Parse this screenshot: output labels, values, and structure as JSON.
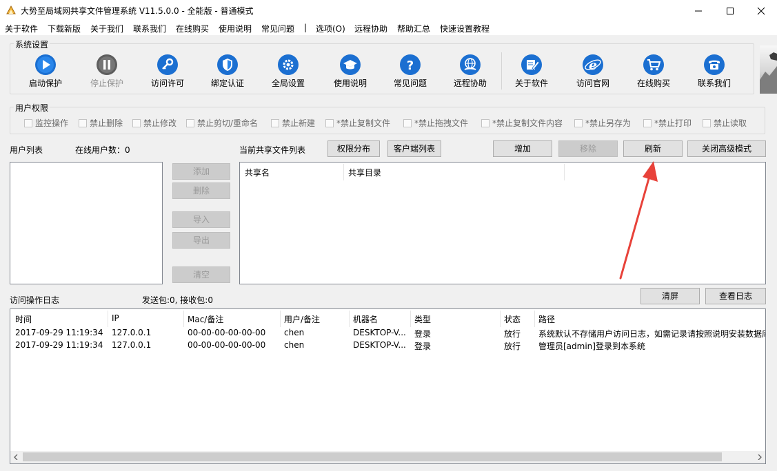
{
  "window": {
    "title": "大势至局域网共享文件管理系统 V11.5.0.0 - 全能版 - 普通模式"
  },
  "menu": {
    "items": [
      "关于软件",
      "下载新版",
      "关于我们",
      "联系我们",
      "在线购买",
      "使用说明",
      "常见问题",
      "|",
      "选项(O)",
      "远程协助",
      "帮助汇总",
      "快速设置教程"
    ]
  },
  "system_settings": {
    "title": "系统设置",
    "buttons": [
      {
        "label": "启动保护",
        "icon": "play-icon",
        "enabled": true
      },
      {
        "label": "停止保护",
        "icon": "pause-icon",
        "enabled": false
      },
      {
        "label": "访问许可",
        "icon": "key-icon",
        "enabled": true
      },
      {
        "label": "绑定认证",
        "icon": "shield-icon",
        "enabled": true
      },
      {
        "label": "全局设置",
        "icon": "gear-icon",
        "enabled": true
      },
      {
        "label": "使用说明",
        "icon": "graduation-cap-icon",
        "enabled": true
      },
      {
        "label": "常见问题",
        "icon": "question-icon",
        "enabled": true
      },
      {
        "label": "远程协助",
        "icon": "globe-hand-icon",
        "enabled": true
      },
      {
        "label": "关于软件",
        "icon": "edit-icon",
        "enabled": true
      },
      {
        "label": "访问官网",
        "icon": "ie-icon",
        "enabled": true
      },
      {
        "label": "在线购买",
        "icon": "cart-icon",
        "enabled": true
      },
      {
        "label": "联系我们",
        "icon": "phone-icon",
        "enabled": true
      }
    ]
  },
  "user_permissions": {
    "title": "用户权限",
    "items": [
      "监控操作",
      "禁止删除",
      "禁止修改",
      "禁止剪切/重命名",
      "禁止新建",
      "*禁止复制文件",
      "*禁止拖拽文件",
      "*禁止复制文件内容",
      "*禁止另存为",
      "*禁止打印",
      "禁止读取"
    ]
  },
  "user_list": {
    "title": "用户列表",
    "online_label": "在线用户数：0",
    "buttons": {
      "add": "添加",
      "delete": "删除",
      "import": "导入",
      "export": "导出",
      "clear": "清空"
    }
  },
  "share_list": {
    "title": "当前共享文件列表",
    "permission_btn": "权限分布",
    "client_btn": "客户端列表",
    "add_btn": "增加",
    "remove_btn": "移除",
    "refresh_btn": "刷新",
    "close_advanced_btn": "关闭高级模式",
    "columns": [
      "共享名",
      "共享目录"
    ]
  },
  "access_log": {
    "title": "访问操作日志",
    "packets": "发送包:0, 接收包:0",
    "clear_btn": "清屏",
    "view_btn": "查看日志",
    "columns": [
      "时间",
      "IP",
      "Mac/备注",
      "用户/备注",
      "机器名",
      "类型",
      "状态",
      "路径"
    ],
    "rows": [
      [
        "2017-09-29 11:19:34",
        "127.0.0.1",
        "00-00-00-00-00-00",
        "chen",
        "DESKTOP-V...",
        "登录",
        "放行",
        "系统默认不存储用户访问日志，如需记录请按照说明安装数据库"
      ],
      [
        "2017-09-29 11:19:34",
        "127.0.0.1",
        "00-00-00-00-00-00",
        "chen",
        "DESKTOP-V...",
        "登录",
        "放行",
        "管理员[admin]登录到本系统"
      ]
    ]
  },
  "colors": {
    "icon_blue": "#1b6fd1",
    "icon_gray": "#6b6b6b",
    "annotation_red": "#e8423a"
  }
}
